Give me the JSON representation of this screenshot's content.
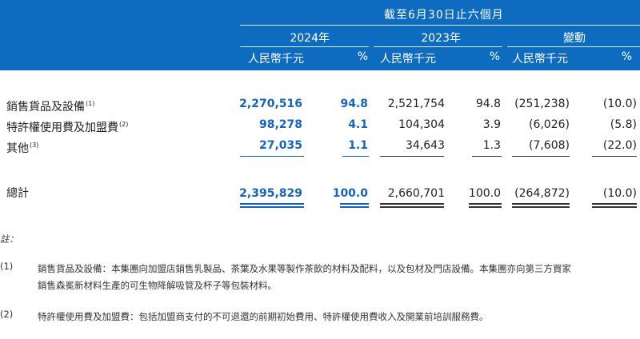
{
  "header": {
    "period": "截至6月30日止六個月",
    "year_2024": "2024年",
    "year_2023": "2023年",
    "change": "變動",
    "unit_rmb": "人民幣千元",
    "unit_pct": "%"
  },
  "rows": [
    {
      "label": "銷售貨品及設備",
      "note": "(1)",
      "v2024": "2,270,516",
      "p2024": "94.8",
      "v2023": "2,521,754",
      "p2023": "94.8",
      "chg": "(251,238)",
      "chg_pct": "(10.0)"
    },
    {
      "label": "特許權使用費及加盟費",
      "note": "(2)",
      "v2024": "98,278",
      "p2024": "4.1",
      "v2023": "104,304",
      "p2023": "3.9",
      "chg": "(6,026)",
      "chg_pct": "(5.8)"
    },
    {
      "label": "其他",
      "note": "(3)",
      "v2024": "27,035",
      "p2024": "1.1",
      "v2023": "34,643",
      "p2023": "1.3",
      "chg": "(7,608)",
      "chg_pct": "(22.0)"
    }
  ],
  "total": {
    "label": "總計",
    "v2024": "2,395,829",
    "p2024": "100.0",
    "v2023": "2,660,701",
    "p2023": "100.0",
    "chg": "(264,872)",
    "chg_pct": "(10.0)"
  },
  "notes": {
    "title": "註：",
    "items": [
      {
        "num": "(1)",
        "line1": "銷售貨品及設備：本集團向加盟店銷售乳製品、茶葉及水果等製作茶飲的材料及配料，以及包材及門店設備。本集團亦向第三方買家",
        "line2": "銷售森冕新材料生產的可生物降解吸管及杯子等包裝材料。"
      },
      {
        "num": "(2)",
        "line1": "特許權使用費及加盟費：包括加盟商支付的不可退還的前期初始費用、特許權使用費收入及開業前培訓服務費。"
      }
    ]
  },
  "colors": {
    "header_bg": "#0d6cbf",
    "highlight_text": "#1565c0"
  }
}
